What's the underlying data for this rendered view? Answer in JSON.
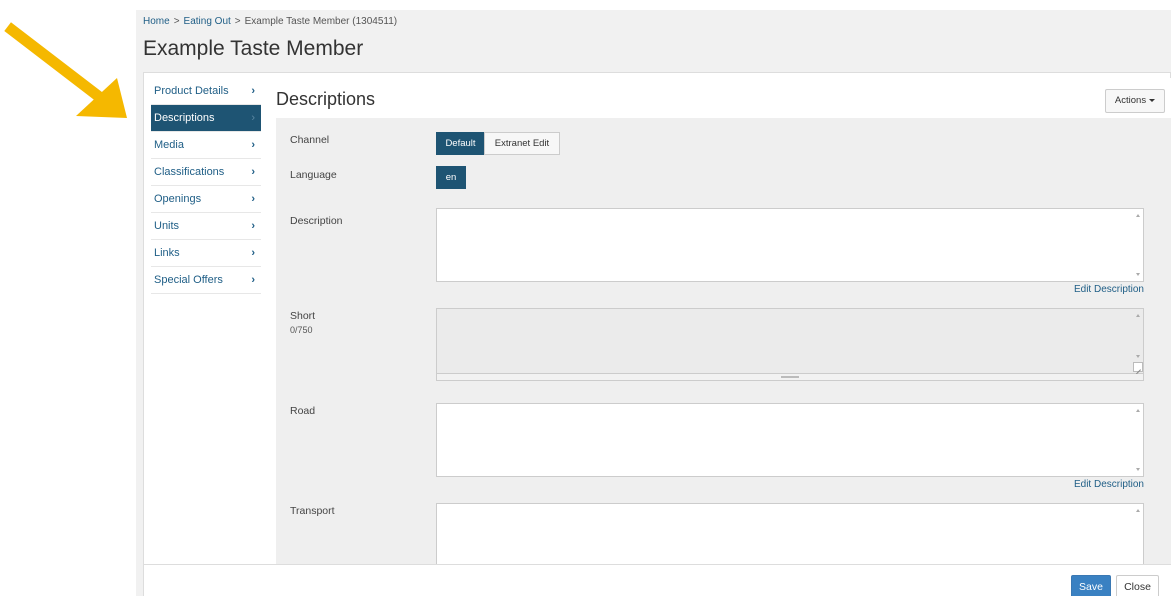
{
  "annotation": {
    "color": "#F5B800",
    "icon": "arrow-icon"
  },
  "breadcrumb": {
    "items": [
      "Home",
      "Eating Out"
    ],
    "separator": ">",
    "current": "Example Taste Member (1304511)"
  },
  "page_title": "Example Taste Member",
  "sidebar": {
    "items": [
      {
        "label": "Product Details",
        "active": false
      },
      {
        "label": "Descriptions",
        "active": true
      },
      {
        "label": "Media",
        "active": false
      },
      {
        "label": "Classifications",
        "active": false
      },
      {
        "label": "Openings",
        "active": false
      },
      {
        "label": "Units",
        "active": false
      },
      {
        "label": "Links",
        "active": false
      },
      {
        "label": "Special Offers",
        "active": false
      }
    ],
    "chevron": "›",
    "active_color": "#1e5473"
  },
  "content": {
    "title": "Descriptions",
    "actions_label": "Actions",
    "channel": {
      "label": "Channel",
      "options": [
        "Default",
        "Extranet Edit"
      ],
      "selected": "Default"
    },
    "language": {
      "label": "Language",
      "options": [
        "en"
      ],
      "selected": "en"
    },
    "description": {
      "label": "Description",
      "value": "",
      "edit_link": "Edit Description"
    },
    "short": {
      "label": "Short",
      "counter": "0/750",
      "value": ""
    },
    "road": {
      "label": "Road",
      "value": "",
      "edit_link": "Edit Description"
    },
    "transport": {
      "label": "Transport",
      "value": ""
    }
  },
  "footer": {
    "save_label": "Save",
    "close_label": "Close",
    "save_color": "#3a81c2"
  }
}
